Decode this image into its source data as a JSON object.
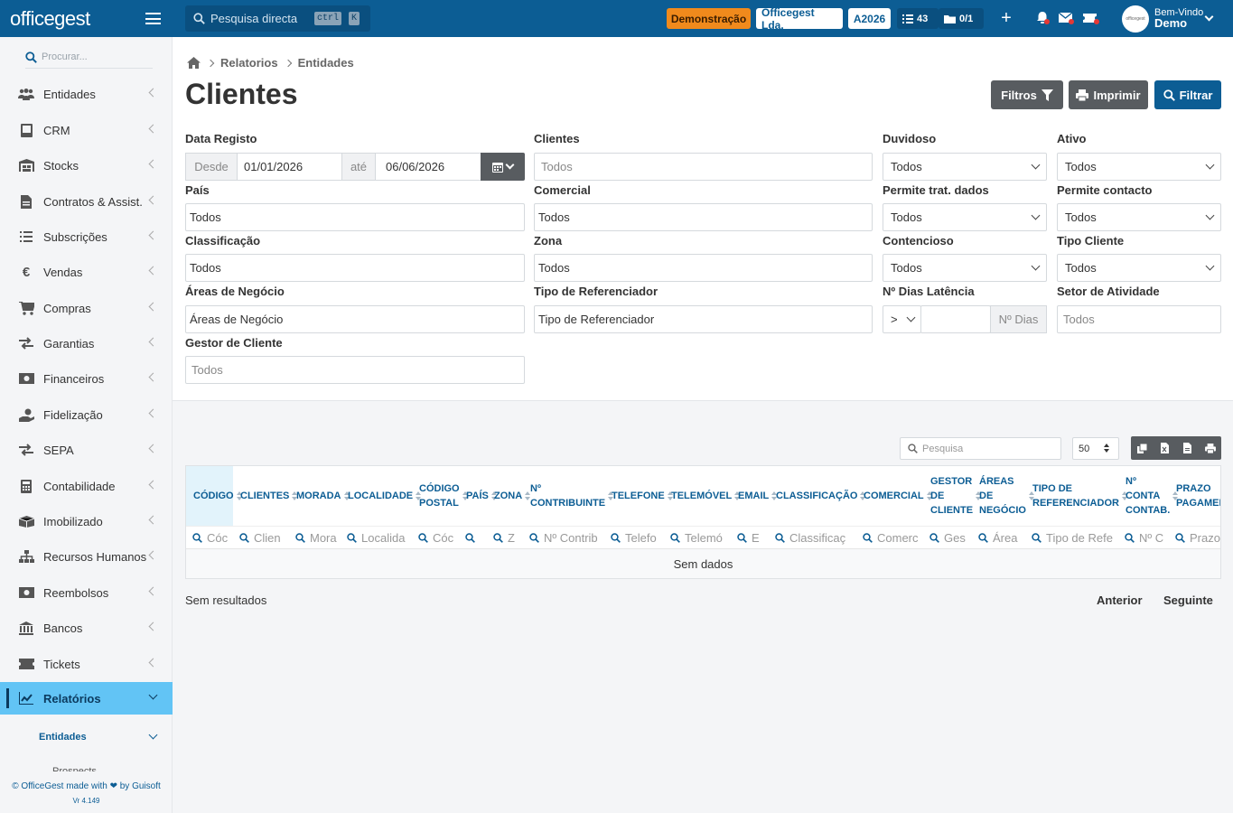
{
  "topbar": {
    "logo": "officegest",
    "search_placeholder": "Pesquisa directa",
    "kbd_ctrl": "ctrl",
    "kbd_k": "K",
    "demo_badge": "Demonstração",
    "company": "Officegest Lda.",
    "year": "A2026",
    "tasks_count": "43",
    "docs_count": "0/1",
    "welcome": "Bem-Vindo",
    "user": "Demo",
    "colors": {
      "bar": "#0c5d94",
      "demo": "#f08a1c"
    }
  },
  "sidebar": {
    "search_placeholder": "Procurar...",
    "items": [
      {
        "label": "Entidades",
        "icon": "users-icon"
      },
      {
        "label": "CRM",
        "icon": "book-icon"
      },
      {
        "label": "Stocks",
        "icon": "warehouse-icon"
      },
      {
        "label": "Contratos & Assist.",
        "icon": "contract-icon"
      },
      {
        "label": "Subscrições",
        "icon": "list-icon"
      },
      {
        "label": "Vendas",
        "icon": "euro-icon"
      },
      {
        "label": "Compras",
        "icon": "cart-icon"
      },
      {
        "label": "Garantias",
        "icon": "exchange-icon"
      },
      {
        "label": "Financeiros",
        "icon": "money-icon"
      },
      {
        "label": "Fidelização",
        "icon": "hand-coin-icon"
      },
      {
        "label": "SEPA",
        "icon": "exchange-icon"
      },
      {
        "label": "Contabilidade",
        "icon": "calculator-icon"
      },
      {
        "label": "Imobilizado",
        "icon": "box-icon"
      },
      {
        "label": "Recursos Humanos",
        "icon": "sitemap-icon"
      },
      {
        "label": "Reembolsos",
        "icon": "money-icon"
      },
      {
        "label": "Bancos",
        "icon": "bank-icon"
      },
      {
        "label": "Tickets",
        "icon": "ticket-icon"
      },
      {
        "label": "Relatórios",
        "icon": "chart-icon"
      }
    ],
    "sub_item": "Entidades",
    "sub_cut": "Prospects",
    "footer": "© OfficeGest made with ❤ by Guisoft",
    "version": "Vr 4.149"
  },
  "breadcrumb": [
    "Relatorios",
    "Entidades"
  ],
  "page_title": "Clientes",
  "buttons": {
    "filtros": "Filtros",
    "imprimir": "Imprimir",
    "filtrar": "Filtrar"
  },
  "filters": {
    "data_registo": "Data Registo",
    "desde": "Desde",
    "date_from": "01/01/2026",
    "ate": "até",
    "date_to": "06/06/2026",
    "clientes": "Clientes",
    "clientes_ph": "Todos",
    "duvidoso": "Duvidoso",
    "duvidoso_val": "Todos",
    "ativo": "Ativo",
    "ativo_val": "Todos",
    "pais": "País",
    "pais_val": "Todos",
    "comercial": "Comercial",
    "comercial_val": "Todos",
    "permite_trat": "Permite trat. dados",
    "permite_trat_val": "Todos",
    "permite_contacto": "Permite contacto",
    "permite_contacto_val": "Todos",
    "classificacao": "Classificação",
    "classificacao_val": "Todos",
    "zona": "Zona",
    "zona_val": "Todos",
    "contencioso": "Contencioso",
    "contencioso_val": "Todos",
    "tipo_cliente": "Tipo Cliente",
    "tipo_cliente_val": "Todos",
    "areas": "Áreas de Negócio",
    "areas_val": "Áreas de Negócio",
    "tipo_ref": "Tipo de Referenciador",
    "tipo_ref_val": "Tipo de Referenciador",
    "dias": "Nº Dias Latência",
    "dias_op": ">",
    "dias_ph": "Nº Dias",
    "setor": "Setor de Atividade",
    "setor_ph": "Todos",
    "gestor": "Gestor de Cliente",
    "gestor_ph": "Todos"
  },
  "table": {
    "search_placeholder": "Pesquisa",
    "page_size": "50",
    "columns": [
      {
        "l1": "CÓDIGO",
        "f": "Cóc"
      },
      {
        "l1": "CLIENTES",
        "f": "Clien"
      },
      {
        "l1": "MORADA",
        "f": "Mora"
      },
      {
        "l1": "LOCALIDADE",
        "f": "Localida"
      },
      {
        "l1": "CÓDIGO",
        "l2": "POSTAL",
        "f": "Cóc"
      },
      {
        "l1": "PAÍS",
        "f": ""
      },
      {
        "l1": "ZONA",
        "f": "Z"
      },
      {
        "l1": "Nº",
        "l2": "CONTRIBUINTE",
        "f": "Nº Contrib"
      },
      {
        "l1": "TELEFONE",
        "f": "Telefo"
      },
      {
        "l1": "TELEMÓVEL",
        "f": "Telemó"
      },
      {
        "l1": "EMAIL",
        "f": "E"
      },
      {
        "l1": "CLASSIFICAÇÃO",
        "f": "Classificaç"
      },
      {
        "l1": "COMERCIAL",
        "f": "Comerc"
      },
      {
        "l1": "GESTOR",
        "l2": "DE",
        "l3": "CLIENTE",
        "f": "Ges"
      },
      {
        "l1": "ÁREAS",
        "l2": "DE",
        "l3": "NEGÓCIO",
        "f": "Área"
      },
      {
        "l1": "TIPO DE",
        "l2": "REFERENCIADOR",
        "f": "Tipo de Refe"
      },
      {
        "l1": "Nº",
        "l2": "CONTA",
        "l3": "CONTAB.",
        "f": "Nº C"
      },
      {
        "l1": "PRAZO",
        "l2": "PAGAMEI",
        "f": "Prazo"
      }
    ],
    "no_data": "Sem dados",
    "results": "Sem resultados",
    "prev": "Anterior",
    "next": "Seguinte"
  }
}
